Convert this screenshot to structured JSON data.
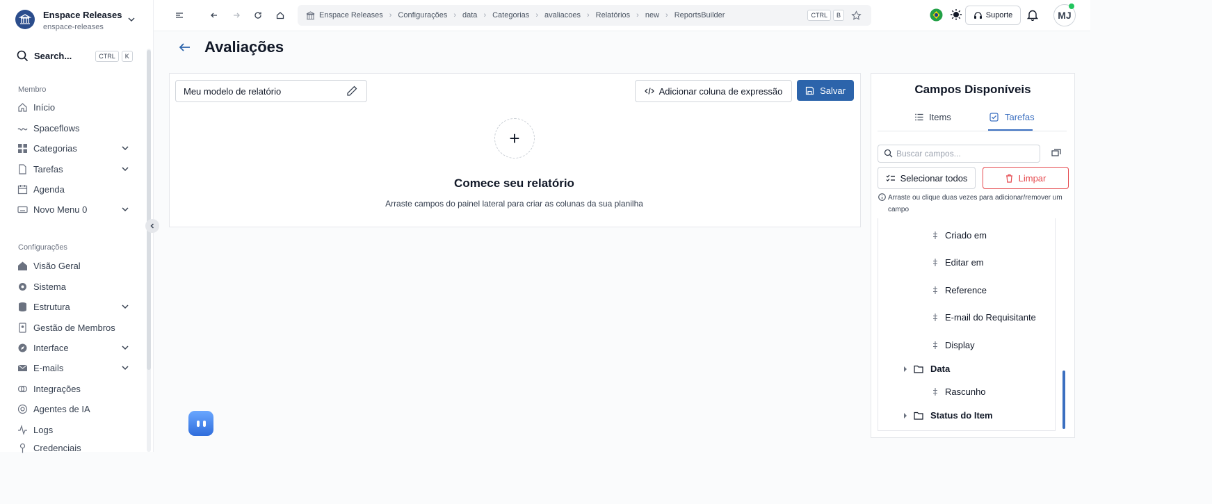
{
  "workspace": {
    "name": "Enspace Releases",
    "slug": "enspace-releases"
  },
  "search": {
    "label": "Search...",
    "kbd1": "CTRL",
    "kbd2": "K"
  },
  "sidebar": {
    "member_title": "Membro",
    "member_items": [
      {
        "label": "Início",
        "icon": "home-icon"
      },
      {
        "label": "Spaceflows",
        "icon": "flow-icon"
      },
      {
        "label": "Categorias",
        "icon": "grid-icon",
        "expandable": true
      },
      {
        "label": "Tarefas",
        "icon": "file-icon",
        "expandable": true
      },
      {
        "label": "Agenda",
        "icon": "calendar-icon"
      },
      {
        "label": "Novo Menu 0",
        "icon": "keyboard-icon",
        "expandable": true
      }
    ],
    "config_title": "Configurações",
    "config_items": [
      {
        "label": "Visão Geral",
        "icon": "home-icon"
      },
      {
        "label": "Sistema",
        "icon": "gear-icon"
      },
      {
        "label": "Estrutura",
        "icon": "database-icon",
        "expandable": true
      },
      {
        "label": "Gestão de Membros",
        "icon": "members-icon"
      },
      {
        "label": "Interface",
        "icon": "compass-icon",
        "expandable": true
      },
      {
        "label": "E-mails",
        "icon": "mail-icon",
        "expandable": true
      },
      {
        "label": "Integrações",
        "icon": "link-icon"
      },
      {
        "label": "Agentes de IA",
        "icon": "ai-icon"
      },
      {
        "label": "Logs",
        "icon": "activity-icon"
      },
      {
        "label": "Credenciais",
        "icon": "key-icon"
      }
    ]
  },
  "breadcrumb": [
    "Enspace Releases",
    "Configurações",
    "data",
    "Categorias",
    "avaliacoes",
    "Relatórios",
    "new",
    "ReportsBuilder"
  ],
  "topbar": {
    "kbd1": "CTRL",
    "kbd2": "B",
    "support_label": "Suporte",
    "avatar_initials": "MJ"
  },
  "page": {
    "title": "Avaliações"
  },
  "builder": {
    "report_name": "Meu modelo de relatório",
    "add_expression_label": "Adicionar coluna de expressão",
    "save_label": "Salvar",
    "empty_title": "Comece seu relatório",
    "empty_subtitle": "Arraste campos do painel lateral para criar as colunas da sua planilha"
  },
  "fields_panel": {
    "title": "Campos Disponíveis",
    "tabs": [
      "Items",
      "Tarefas"
    ],
    "active_tab": "Tarefas",
    "search_placeholder": "Buscar campos...",
    "select_all_label": "Selecionar todos",
    "clear_label": "Limpar",
    "hint": "Arraste ou clique duas vezes para adicionar/remover um campo",
    "fields": [
      "Criado em",
      "Editar em",
      "Reference",
      "E-mail do Requisitante",
      "Display"
    ],
    "folder_data": "Data",
    "folder_data_field": "Rascunho",
    "folder_status": "Status do Item"
  },
  "colors": {
    "primary": "#2c64ab",
    "danger": "#e5484d",
    "accent": "#3b6fc0"
  }
}
